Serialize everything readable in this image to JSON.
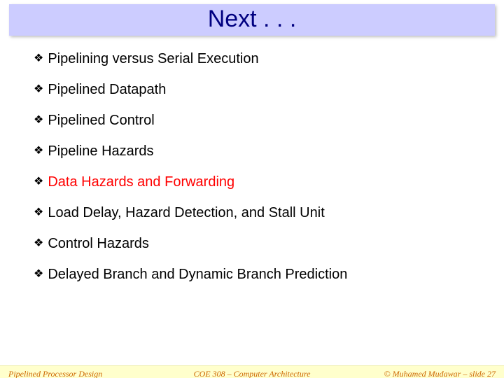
{
  "title": "Next . . .",
  "bullets": [
    {
      "text": "Pipelining versus Serial Execution",
      "highlight": false
    },
    {
      "text": "Pipelined Datapath",
      "highlight": false
    },
    {
      "text": "Pipelined Control",
      "highlight": false
    },
    {
      "text": "Pipeline Hazards",
      "highlight": false
    },
    {
      "text": "Data Hazards and Forwarding",
      "highlight": true
    },
    {
      "text": "Load Delay, Hazard Detection, and Stall Unit",
      "highlight": false
    },
    {
      "text": "Control Hazards",
      "highlight": false
    },
    {
      "text": "Delayed Branch and Dynamic Branch Prediction",
      "highlight": false
    }
  ],
  "footer": {
    "left": "Pipelined Processor Design",
    "center": "COE 308 – Computer Architecture",
    "right": "© Muhamed Mudawar – slide 27"
  },
  "bullet_glyph": "❖"
}
